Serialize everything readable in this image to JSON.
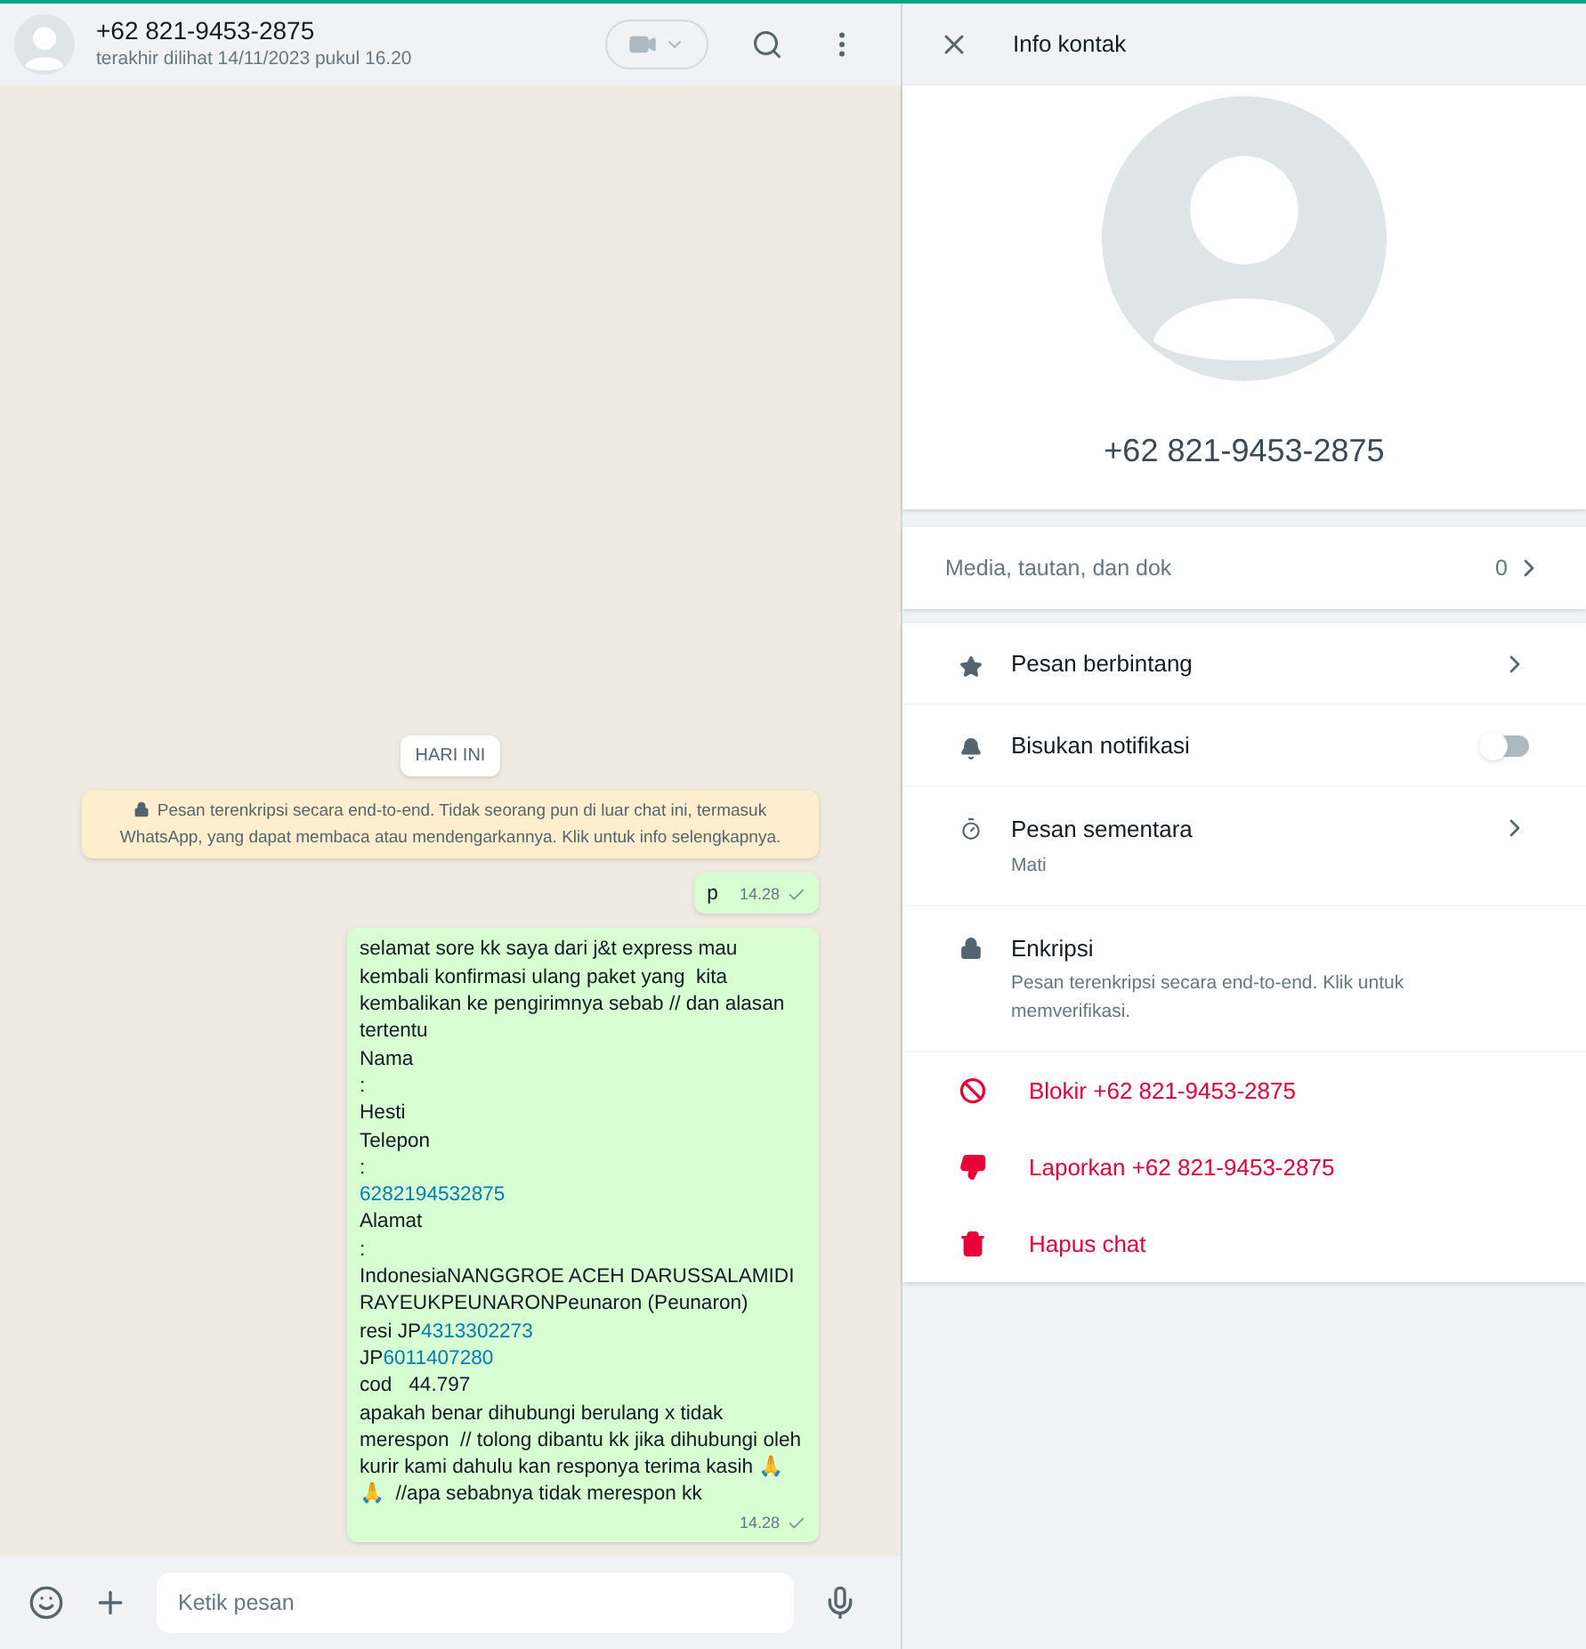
{
  "chat_header": {
    "name": "+62 821-9453-2875",
    "status": "terakhir dilihat 14/11/2023 pukul 16.20"
  },
  "date_chip": "HARI INI",
  "encryption_notice": "Pesan terenkripsi secara end-to-end. Tidak seorang pun di luar chat ini, termasuk WhatsApp, yang dapat membaca atau mendengarkannya. Klik untuk info selengkapnya.",
  "messages": [
    {
      "time": "14.28",
      "lines": [
        [
          {
            "kind": "text",
            "text": "p"
          }
        ]
      ]
    },
    {
      "time": "14.28",
      "lines": [
        [
          {
            "kind": "text",
            "text": "selamat sore kk saya dari j&t express mau kembali konfirmasi ulang paket yang  kita kembalikan ke pengirimnya sebab // dan alasan tertentu"
          }
        ],
        [
          {
            "kind": "text",
            "text": "Nama"
          }
        ],
        [
          {
            "kind": "text",
            "text": ":"
          }
        ],
        [
          {
            "kind": "text",
            "text": "Hesti"
          }
        ],
        [
          {
            "kind": "text",
            "text": "Telepon"
          }
        ],
        [
          {
            "kind": "text",
            "text": ":"
          }
        ],
        [
          {
            "kind": "link",
            "text": "6282194532875"
          }
        ],
        [
          {
            "kind": "text",
            "text": "Alamat"
          }
        ],
        [
          {
            "kind": "text",
            "text": ":"
          }
        ],
        [
          {
            "kind": "text",
            "text": "IndonesiaNANGGROE ACEH DARUSSALAMIDI RAYEUKPEUNARONPeunaron (Peunaron)"
          }
        ],
        [
          {
            "kind": "text",
            "text": "resi JP"
          },
          {
            "kind": "link",
            "text": "4313302273"
          }
        ],
        [
          {
            "kind": "text",
            "text": "JP"
          },
          {
            "kind": "link",
            "text": "6011407280"
          }
        ],
        [
          {
            "kind": "text",
            "text": "cod   44.797"
          }
        ],
        [
          {
            "kind": "text",
            "text": "apakah benar dihubungi berulang x tidak merespon  // tolong dibantu kk jika dihubungi oleh kurir kami dahulu kan responya terima kasih 🙏🙏  //apa sebabnya tidak merespon kk"
          }
        ]
      ]
    }
  ],
  "composer": {
    "placeholder": "Ketik pesan"
  },
  "info_panel": {
    "title": "Info kontak",
    "phone": "+62 821-9453-2875",
    "media": {
      "label": "Media, tautan, dan dok",
      "count": "0"
    },
    "items": [
      {
        "kind": "link",
        "label": "Pesan berbintang"
      },
      {
        "kind": "toggle",
        "label": "Bisukan notifikasi",
        "on": false
      },
      {
        "kind": "link",
        "label": "Pesan sementara",
        "sub": "Mati"
      },
      {
        "kind": "info",
        "label": "Enkripsi",
        "sub": "Pesan terenkripsi secara end-to-end. Klik untuk memverifikasi."
      }
    ],
    "actions": [
      {
        "label": "Blokir +62 821-9453-2875"
      },
      {
        "label": "Laporkan +62 821-9453-2875"
      },
      {
        "label": "Hapus chat"
      }
    ]
  }
}
